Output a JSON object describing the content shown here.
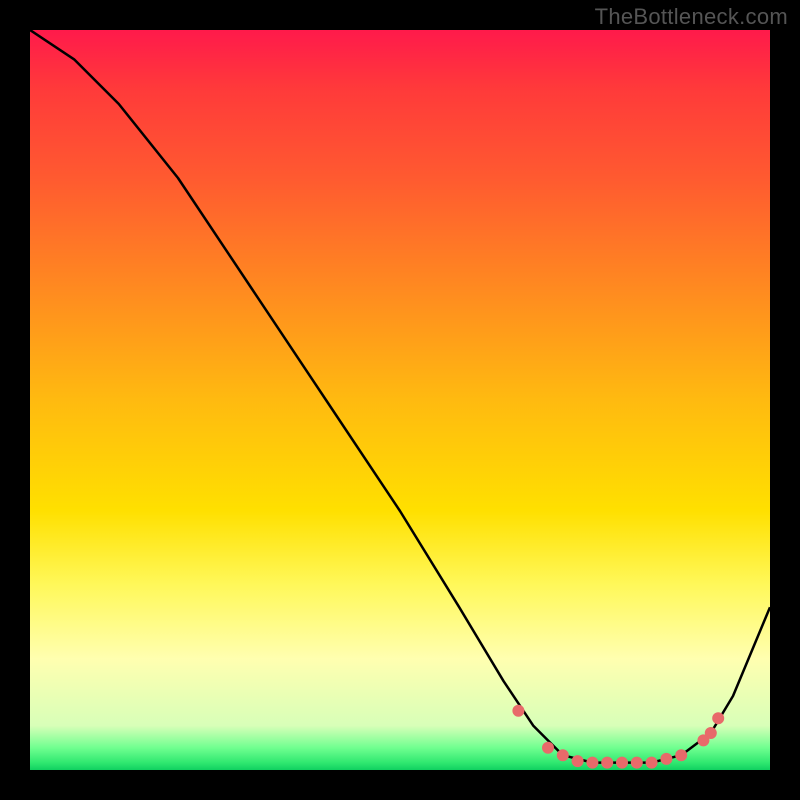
{
  "watermark": "TheBottleneck.com",
  "chart_data": {
    "type": "line",
    "title": "",
    "xlabel": "",
    "ylabel": "",
    "xlim": [
      0,
      100
    ],
    "ylim": [
      0,
      100
    ],
    "series": [
      {
        "name": "bottleneck-curve",
        "x": [
          0,
          6,
          12,
          20,
          30,
          40,
          50,
          58,
          64,
          68,
          72,
          76,
          80,
          84,
          88,
          92,
          95,
          100
        ],
        "y": [
          100,
          96,
          90,
          80,
          65,
          50,
          35,
          22,
          12,
          6,
          2,
          1,
          1,
          1,
          2,
          5,
          10,
          22
        ]
      }
    ],
    "markers": {
      "name": "highlight-points",
      "x": [
        66,
        70,
        72,
        74,
        76,
        78,
        80,
        82,
        84,
        86,
        88,
        91,
        92,
        93
      ],
      "y": [
        8,
        3,
        2,
        1.2,
        1,
        1,
        1,
        1,
        1,
        1.5,
        2,
        4,
        5,
        7
      ]
    },
    "background_style": "rainbow-vertical-gradient",
    "colors": {
      "line": "#000000",
      "marker": "#e86a6a"
    }
  }
}
